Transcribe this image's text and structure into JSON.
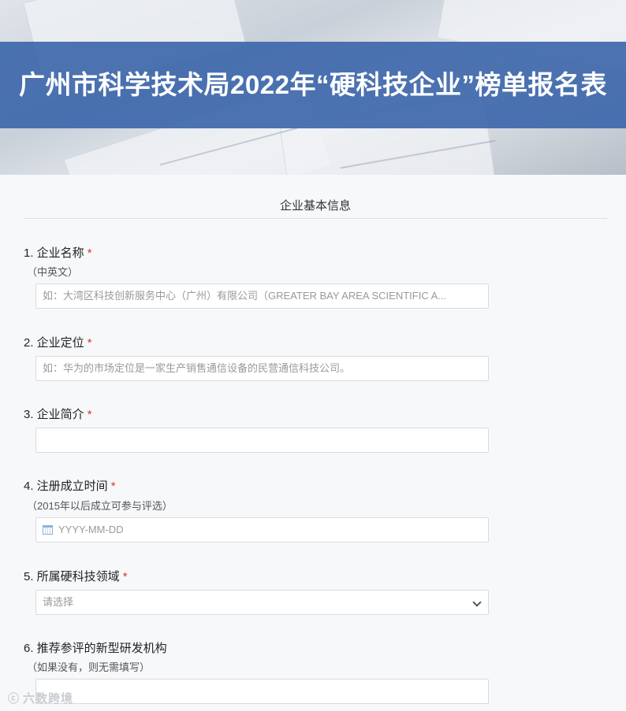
{
  "header": {
    "title": "广州市科学技术局2022年“硬科技企业”榜单报名表"
  },
  "section": {
    "title": "企业基本信息"
  },
  "questions": [
    {
      "label": "1. 企业名称",
      "required": "*",
      "hint": "（中英文）",
      "placeholder": "如：大湾区科技创新服务中心（广州）有限公司（GREATER BAY AREA SCIENTIFIC A..."
    },
    {
      "label": "2. 企业定位",
      "required": "*",
      "placeholder": "如：华为的市场定位是一家生产销售通信设备的民营通信科技公司。"
    },
    {
      "label": "3.  企业简介",
      "required": "*",
      "placeholder": ""
    },
    {
      "label": "4. 注册成立时间",
      "required": "*",
      "hint": "（2015年以后成立可参与评选）",
      "placeholder": "YYYY-MM-DD"
    },
    {
      "label": "5. 所属硬科技领域",
      "required": "*",
      "placeholder": "请选择"
    },
    {
      "label": "6. 推荐参评的新型研发机构",
      "hint": "（如果没有，则无需填写）",
      "placeholder": ""
    }
  ],
  "watermark": {
    "text": "六数跨境",
    "icon": "logo-icon"
  },
  "colors": {
    "title_bar": "#3e67aa",
    "required": "#e03131",
    "page_bg": "#f7f8fa"
  }
}
